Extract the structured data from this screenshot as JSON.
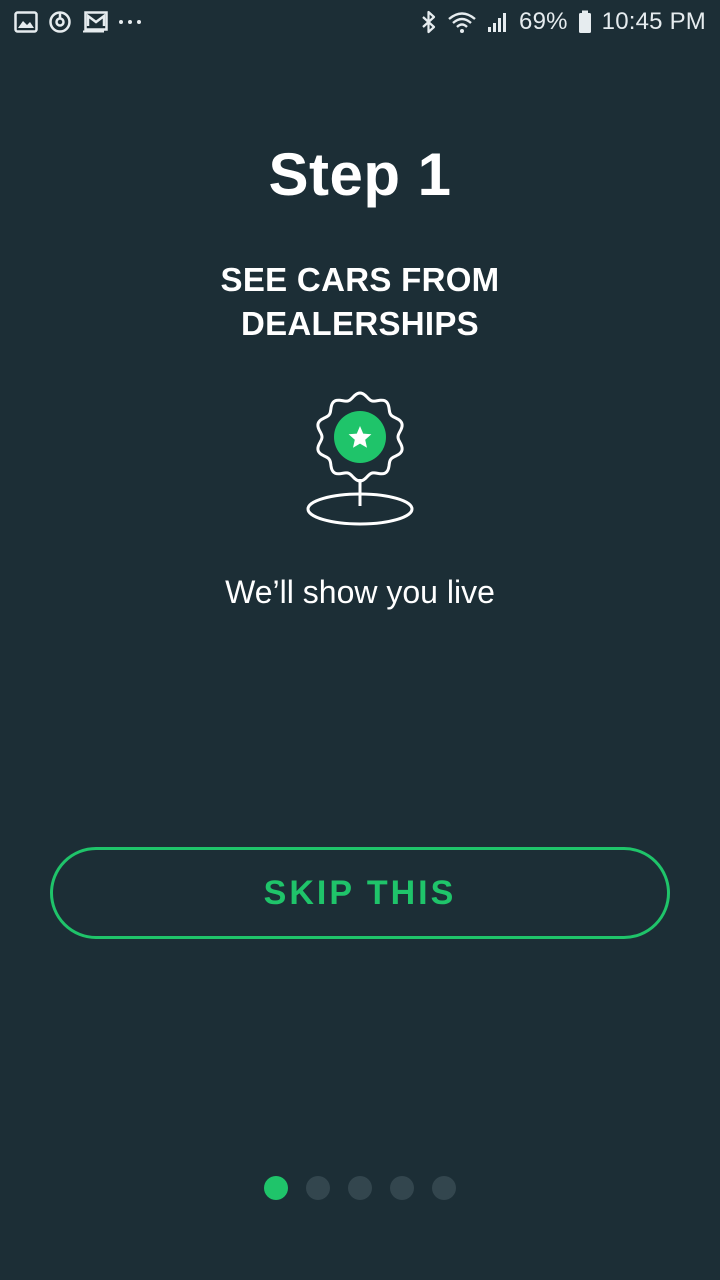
{
  "status_bar": {
    "left_icons": [
      "gallery-icon",
      "sync-icon",
      "mail-icon",
      "more-dots-icon"
    ],
    "battery_percent": "69%",
    "time": "10:45 PM",
    "right_icons": [
      "bluetooth-icon",
      "wifi-icon",
      "signal-icon",
      "battery-icon"
    ]
  },
  "onboarding": {
    "step_title": "Step 1",
    "headline": "SEE CARS FROM DEALERSHIPS",
    "icon": "location-badge-star-icon",
    "caption": "We’ll show you live",
    "skip_label": "SKIP THIS"
  },
  "pager": {
    "total": 5,
    "active_index": 0
  },
  "colors": {
    "background": "#1c2e36",
    "accent": "#1fc46a",
    "inactive_dot": "#33464e",
    "text": "#ffffff"
  }
}
